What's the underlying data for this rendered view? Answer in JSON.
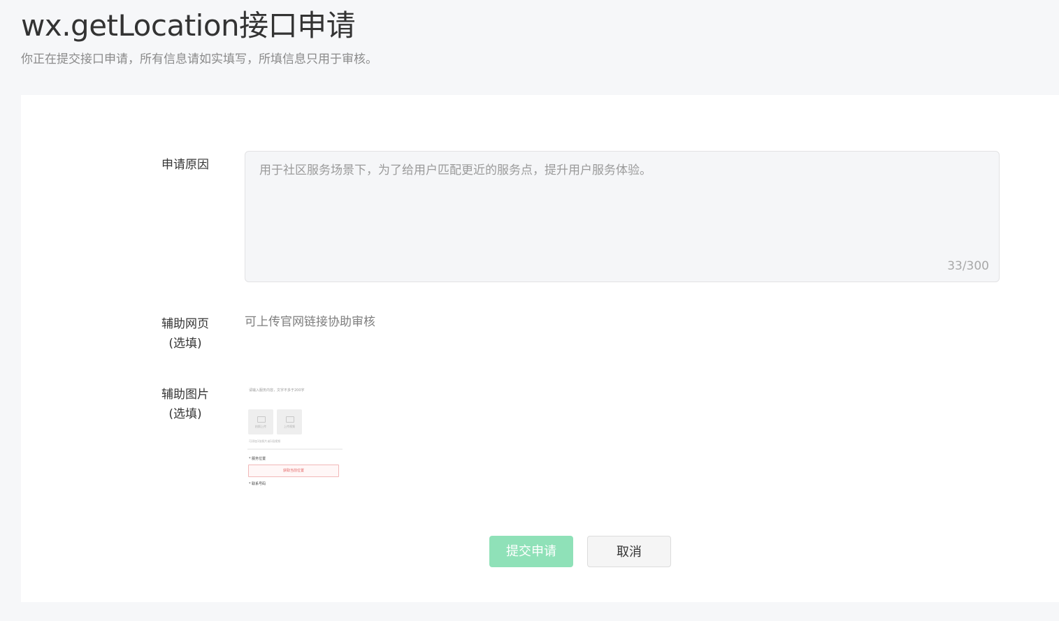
{
  "header": {
    "title": "wx.getLocation接口申请",
    "subtitle": "你正在提交接口申请，所有信息请如实填写，所填信息只用于审核。"
  },
  "form": {
    "reason": {
      "label": "申请原因",
      "value": "用于社区服务场景下，为了给用户匹配更近的服务点，提升用户服务体验。",
      "counter": "33/300"
    },
    "web_page": {
      "label_line1": "辅助网页",
      "label_line2": "(选填)",
      "hint": "可上传官网链接协助审核"
    },
    "image": {
      "label_line1": "辅助图片",
      "label_line2": "(选填)",
      "sample": {
        "line1": "请输入服务内容，文字不多于200字",
        "box1_label": "拍照上传",
        "box2_label": "上传视频",
        "note": "可添加1张照片或1段视频",
        "location_label": "* 服务位置",
        "location_button": "获取当前位置",
        "phone_label": "* 联系号码"
      }
    }
  },
  "actions": {
    "submit_label": "提交申请",
    "cancel_label": "取消"
  },
  "colors": {
    "submit_bg": "#8ae0b5",
    "page_bg": "#f6f7f9"
  }
}
